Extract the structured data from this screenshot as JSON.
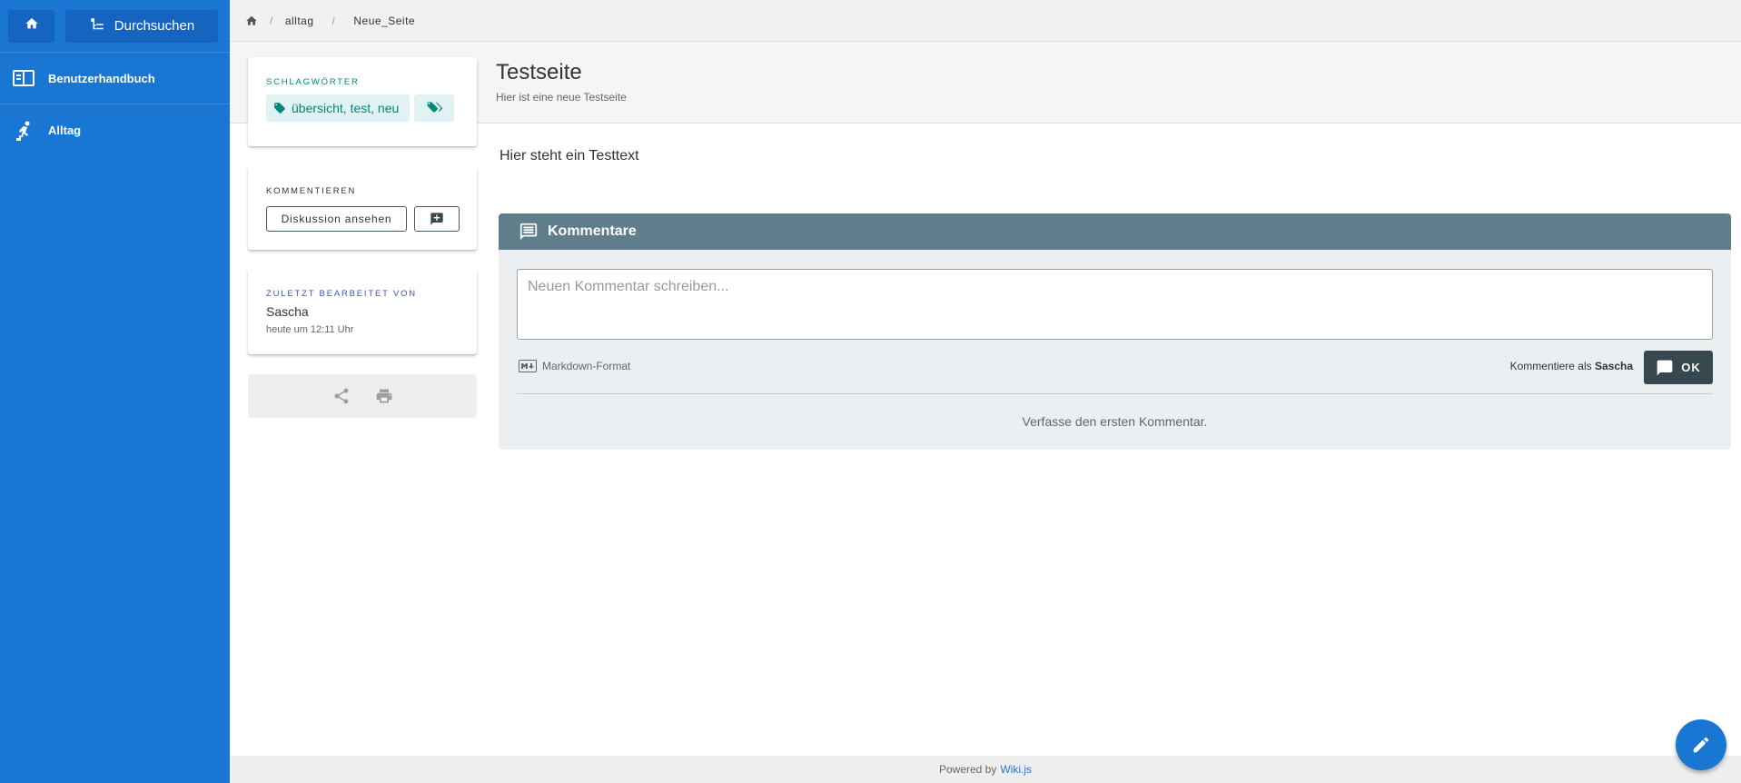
{
  "sidebar": {
    "browse_label": "Durchsuchen",
    "items": [
      {
        "label": "Benutzerhandbuch",
        "icon": "book-open-icon"
      },
      {
        "label": "Alltag",
        "icon": "stairs-person-icon"
      }
    ]
  },
  "breadcrumb": {
    "items": [
      "alltag",
      "Neue_Seite"
    ],
    "separator": "/"
  },
  "page": {
    "title": "Testseite",
    "subtitle": "Hier ist eine neue Testseite",
    "content": "Hier steht ein Testtext"
  },
  "tags_card": {
    "label": "Schlagwörter",
    "tags": "übersicht, test, neu"
  },
  "comment_card": {
    "label": "Kommentieren",
    "discuss_label": "Diskussion ansehen"
  },
  "edited_card": {
    "label": "Zuletzt bearbeitet von",
    "author": "Sascha",
    "time": "heute um 12:11 Uhr"
  },
  "comments": {
    "header": "Kommentare",
    "placeholder": "Neuen Kommentar schreiben...",
    "markdown_label": "Markdown-Format",
    "comment_as_prefix": "Kommentiere als",
    "comment_as_user": "Sascha",
    "ok_label": "OK",
    "empty_message": "Verfasse den ersten Kommentar."
  },
  "footer": {
    "powered_by": "Powered by",
    "link_label": "Wiki.js"
  },
  "colors": {
    "sidebar": "#1976d2",
    "tag_accent": "#00897b",
    "comments_header": "#607d8b",
    "ok_button": "#37474f"
  }
}
